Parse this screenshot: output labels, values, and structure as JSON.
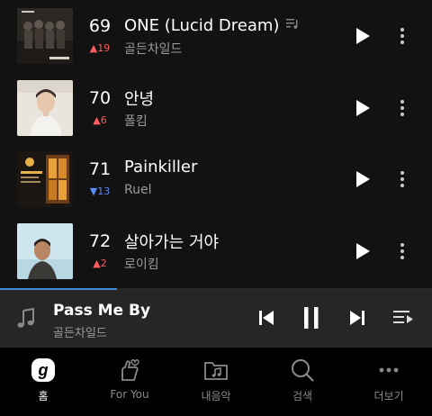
{
  "chart_rows": [
    {
      "rank": "69",
      "trend_dir": "up",
      "trend_value": "19",
      "title": "ONE (Lucid Dream)",
      "artist": "골든차일드",
      "has_lyrics": true
    },
    {
      "rank": "70",
      "trend_dir": "up",
      "trend_value": "6",
      "title": "안녕",
      "artist": "폴킴",
      "has_lyrics": false
    },
    {
      "rank": "71",
      "trend_dir": "down",
      "trend_value": "13",
      "title": "Painkiller",
      "artist": "Ruel",
      "has_lyrics": false
    },
    {
      "rank": "72",
      "trend_dir": "up",
      "trend_value": "2",
      "title": "살아가는 거야",
      "artist": "로이킴",
      "has_lyrics": false
    }
  ],
  "mini_player": {
    "title": "Pass Me By",
    "artist": "골든차일드",
    "progress": 0.27
  },
  "tabbar": {
    "items": [
      {
        "id": "home",
        "label": "홈",
        "icon": "genie-g-icon",
        "active": true
      },
      {
        "id": "foryou",
        "label": "For You",
        "icon": "hand-heart-icon",
        "active": false
      },
      {
        "id": "mymusic",
        "label": "내음악",
        "icon": "music-folder-icon",
        "active": false
      },
      {
        "id": "search",
        "label": "검색",
        "icon": "search-icon",
        "active": false
      },
      {
        "id": "more",
        "label": "더보기",
        "icon": "more-dots-icon",
        "active": false
      }
    ]
  },
  "colors": {
    "background": "#121212",
    "trend_up": "#ff5d5d",
    "trend_down": "#5b8cff",
    "progress": "#3d8bd4",
    "mini_player_bg": "#262626",
    "tabbar_bg": "#000000"
  }
}
